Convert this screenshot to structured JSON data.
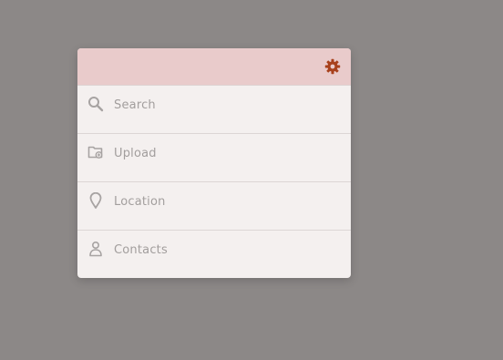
{
  "menu": {
    "settings_icon": "gear-icon",
    "accent_color": "#a8411c",
    "header_color": "#e9cbcb",
    "items": [
      {
        "label": "Search",
        "icon": "search-icon"
      },
      {
        "label": "Upload",
        "icon": "folder-upload-icon"
      },
      {
        "label": "Location",
        "icon": "location-pin-icon"
      },
      {
        "label": "Contacts",
        "icon": "person-icon"
      }
    ]
  }
}
